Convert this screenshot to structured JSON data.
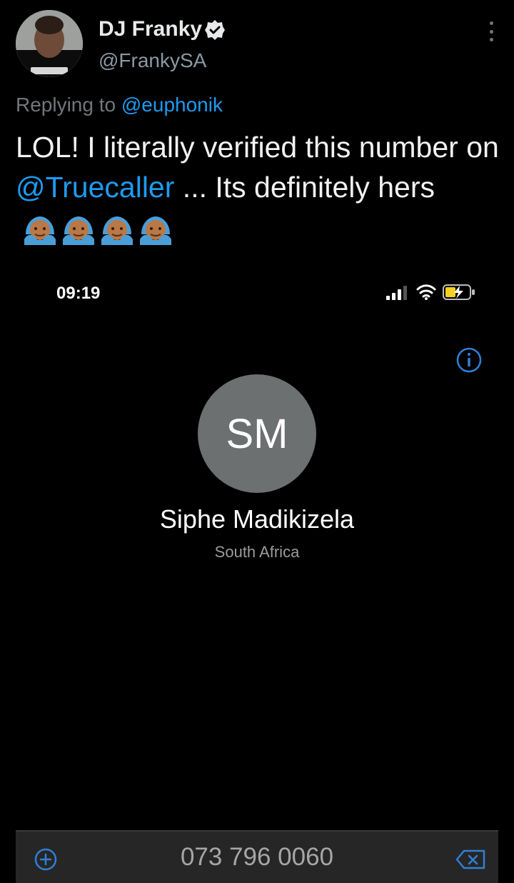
{
  "tweet": {
    "author_name": "DJ Franky",
    "author_handle": "@FrankySA",
    "reply_prefix": "Replying to",
    "reply_to": "@euphonik",
    "text_part1": "LOL! I literally verified this number on",
    "text_mention": "@Truecaller",
    "text_part2": "... Its definitely hers",
    "emoji_name": "face-palm-emoji",
    "emoji_count": 4,
    "accent_color": "#1d9bf0"
  },
  "phone_screen": {
    "status_time": "09:19",
    "contact_initials": "SM",
    "contact_name": "Siphe Madikizela",
    "contact_location": "South Africa",
    "dialed_number": "073 796 0060",
    "icons": {
      "info": "info-icon",
      "add": "add-icon",
      "backspace": "backspace-icon",
      "signal": "signal-icon",
      "wifi": "wifi-icon",
      "battery": "battery-icon"
    },
    "accent_color": "#2f80d6"
  }
}
